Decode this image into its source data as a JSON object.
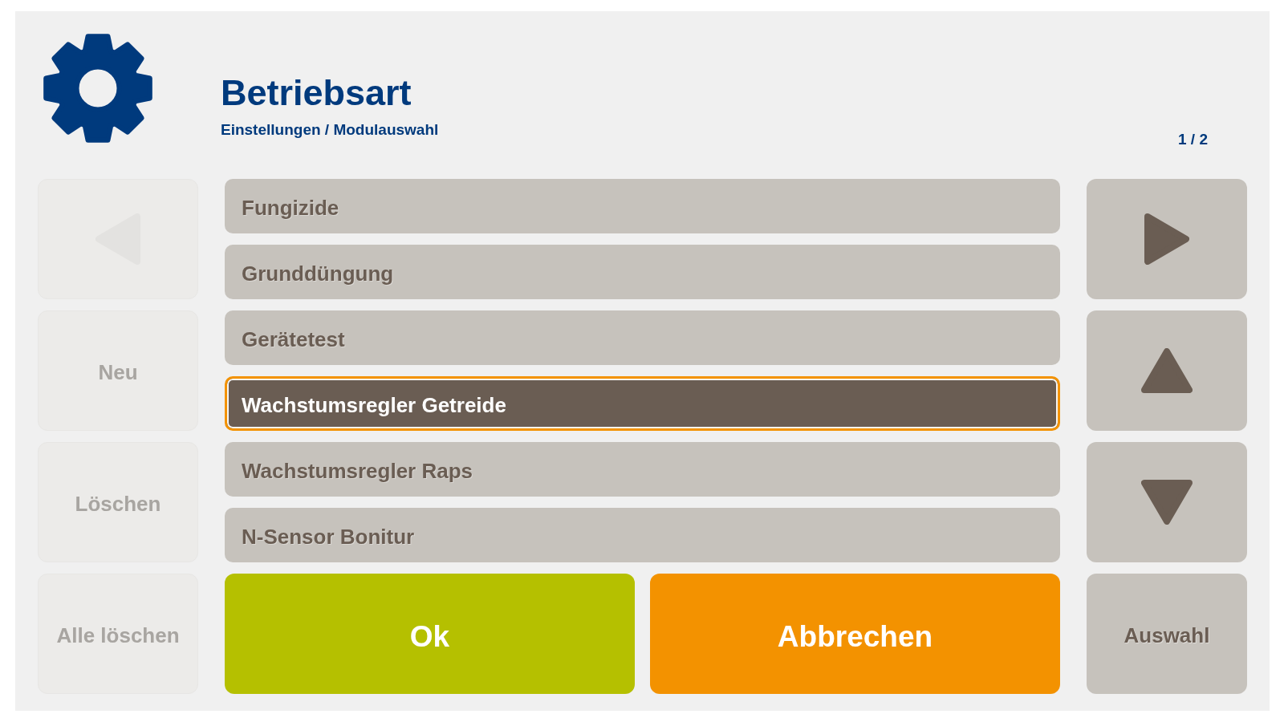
{
  "header": {
    "title": "Betriebsart",
    "breadcrumb": "Einstellungen / Modulauswahl",
    "page_indicator": "1 / 2"
  },
  "left_buttons": [
    {
      "kind": "previous",
      "disabled": true
    },
    {
      "kind": "label",
      "label": "Neu",
      "disabled": true
    },
    {
      "kind": "label",
      "label": "Löschen",
      "disabled": true
    },
    {
      "kind": "label",
      "label": "Alle löschen",
      "disabled": true
    }
  ],
  "list": {
    "items": [
      {
        "label": "Fungizide",
        "selected": false
      },
      {
        "label": "Grunddüngung",
        "selected": false
      },
      {
        "label": "Gerätetest",
        "selected": false
      },
      {
        "label": "Wachstumsregler Getreide",
        "selected": true
      },
      {
        "label": "Wachstumsregler Raps",
        "selected": false
      },
      {
        "label": "N-Sensor Bonitur",
        "selected": false
      }
    ]
  },
  "actions": [
    {
      "kind": "confirm",
      "label": "Ok"
    },
    {
      "kind": "cancel",
      "label": "Abbrechen"
    }
  ],
  "right_buttons": [
    {
      "kind": "next",
      "disabled": false
    },
    {
      "kind": "scroll-up",
      "disabled": false
    },
    {
      "kind": "scroll-down",
      "disabled": false
    },
    {
      "kind": "label",
      "label": "Auswahl",
      "disabled": false
    }
  ]
}
